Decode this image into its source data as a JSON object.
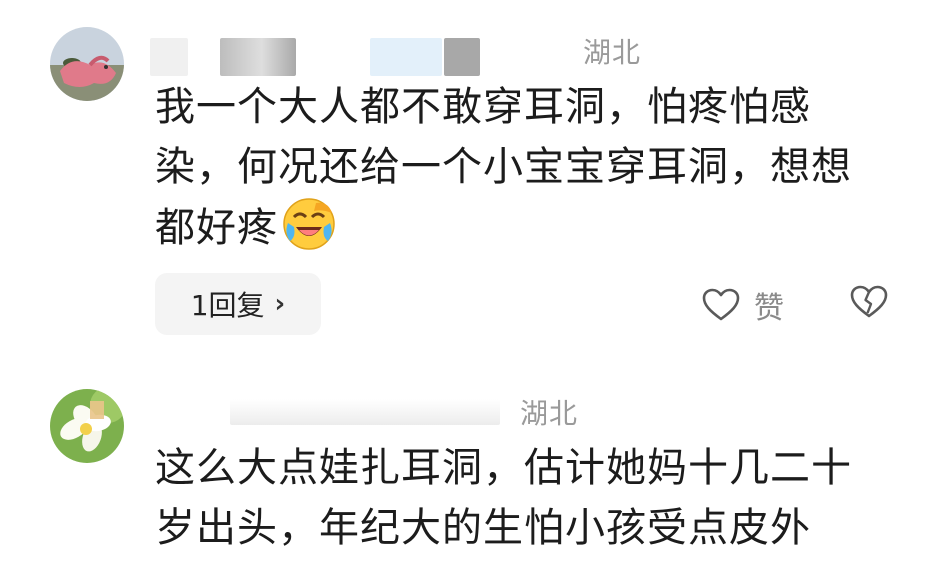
{
  "comments": [
    {
      "location": "湖北",
      "text_lines": [
        "我一个大人都不敢穿耳洞，怕疼怕感",
        "染，何况还给一个小宝宝穿耳洞，想想",
        "都好疼"
      ],
      "emoji": "laughing-crying-emoji",
      "reply_label": "1回复",
      "like_label": "赞"
    },
    {
      "meta": "",
      "location": "湖北",
      "text_lines": [
        "这么大点娃扎耳洞，估计她妈十几二十",
        "岁出头，年纪大的生怕小孩受点皮外"
      ]
    }
  ],
  "colors": {
    "background": "#ffffff",
    "text": "#1c1c1c",
    "muted": "#9a9a9a",
    "reply_bg": "#f4f4f4"
  },
  "icons": {
    "reply_chevron": "chevron-right-icon",
    "like": "heart-outline-icon",
    "dislike": "broken-heart-icon"
  }
}
